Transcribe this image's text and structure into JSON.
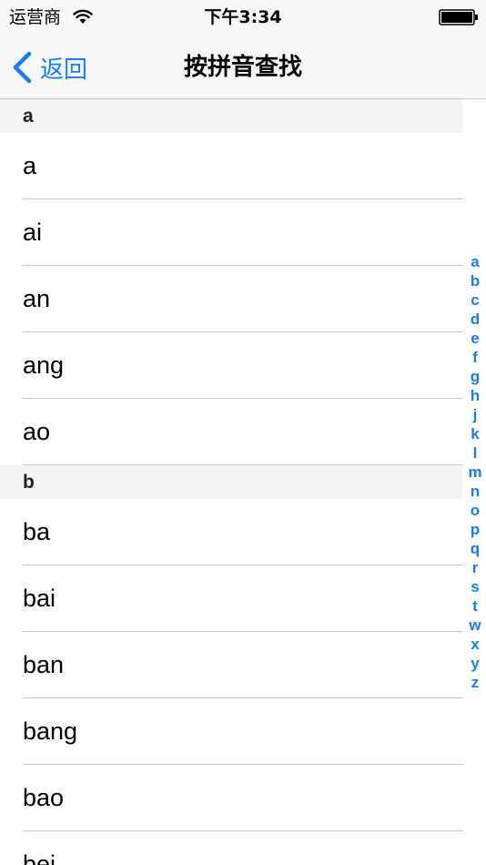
{
  "status_bar": {
    "carrier": "运营商",
    "time": "下午3:34"
  },
  "nav": {
    "back_label": "返回",
    "title": "按拼音查找"
  },
  "colors": {
    "accent": "#1a7cf4",
    "bar_background": "#f7f7f7",
    "section_background": "#f4f4f4",
    "separator": "#c8c7cc"
  },
  "sections": [
    {
      "header": "a",
      "items": [
        "a",
        "ai",
        "an",
        "ang",
        "ao"
      ]
    },
    {
      "header": "b",
      "items": [
        "ba",
        "bai",
        "ban",
        "bang",
        "bao",
        "bei"
      ]
    }
  ],
  "index_letters": [
    "a",
    "b",
    "c",
    "d",
    "e",
    "f",
    "g",
    "h",
    "j",
    "k",
    "l",
    "m",
    "n",
    "o",
    "p",
    "q",
    "r",
    "s",
    "t",
    "w",
    "x",
    "y",
    "z"
  ]
}
